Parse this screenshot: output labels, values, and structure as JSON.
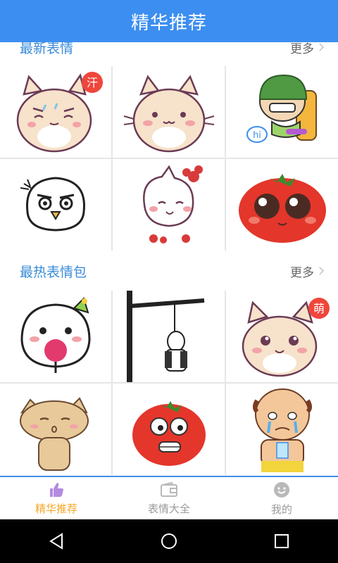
{
  "appbar": {
    "title": "精华推荐"
  },
  "sections": {
    "latest": {
      "title": "最新表情",
      "more": "更多"
    },
    "hot": {
      "title": "最热表情包",
      "more": "更多"
    }
  },
  "stickers": {
    "latest": [
      {
        "name": "sweat-cat",
        "badge": "汗"
      },
      {
        "name": "happy-cat",
        "badge": ""
      },
      {
        "name": "helmet-boy",
        "badge": "hi"
      },
      {
        "name": "angry-blob",
        "badge": ""
      },
      {
        "name": "flower-cat",
        "badge": ""
      },
      {
        "name": "tomato",
        "badge": ""
      }
    ],
    "hot": [
      {
        "name": "lollipop-blob",
        "badge": ""
      },
      {
        "name": "hanging-panda",
        "badge": ""
      },
      {
        "name": "cute-cat",
        "badge": "萌"
      },
      {
        "name": "tabby-cat",
        "badge": ""
      },
      {
        "name": "scared-tomato",
        "badge": ""
      },
      {
        "name": "crying-man",
        "badge": ""
      }
    ]
  },
  "bottom_nav": [
    {
      "label": "精华推荐",
      "icon": "thumbs-up-icon",
      "active": true
    },
    {
      "label": "表情大全",
      "icon": "wallet-icon",
      "active": false
    },
    {
      "label": "我的",
      "icon": "smiley-icon",
      "active": false
    }
  ],
  "colors": {
    "accent": "#3c8ef0",
    "active_tab": "#f5a623",
    "section_title": "#3a8bd8"
  }
}
